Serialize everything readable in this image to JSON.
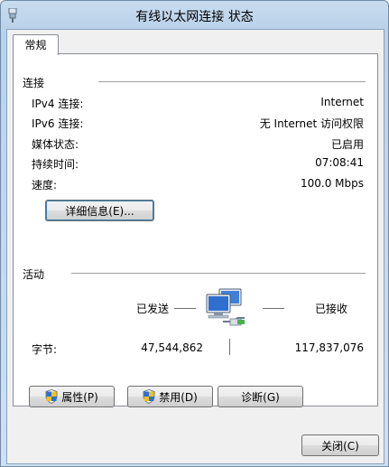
{
  "window": {
    "title": "有线以太网连接 状态"
  },
  "tabs": [
    {
      "label": "常规"
    }
  ],
  "connection": {
    "heading": "连接",
    "rows": [
      {
        "label": "IPv4 连接:",
        "value": "Internet"
      },
      {
        "label": "IPv6 连接:",
        "value": "无 Internet 访问权限"
      },
      {
        "label": "媒体状态:",
        "value": "已启用"
      },
      {
        "label": "持续时间:",
        "value": "07:08:41"
      },
      {
        "label": "速度:",
        "value": "100.0 Mbps"
      }
    ],
    "details_button": "详细信息(E)..."
  },
  "activity": {
    "heading": "活动",
    "sent_label": "已发送",
    "received_label": "已接收",
    "bytes_label": "字节:",
    "bytes_sent": "47,544,862",
    "bytes_received": "117,837,076"
  },
  "buttons": {
    "properties": "属性(P)",
    "disable": "禁用(D)",
    "diagnose": "诊断(G)",
    "close": "关闭(C)"
  },
  "icons": {
    "title": "network-adapter-icon",
    "activity": "network-computers-icon",
    "shield": "uac-shield-icon"
  },
  "colors": {
    "titlebar": "#b9d1ea",
    "button_default_border": "#3c7fb1"
  }
}
